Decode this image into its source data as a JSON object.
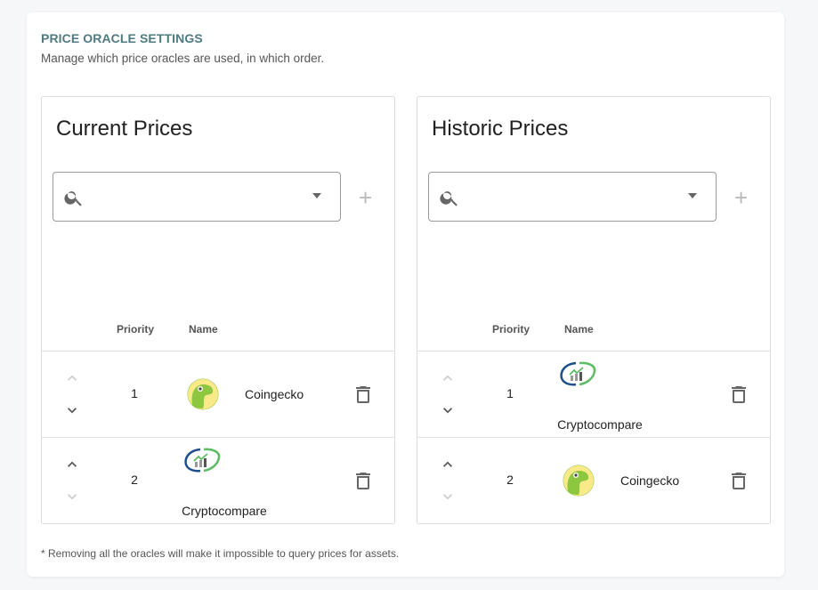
{
  "section": {
    "title": "PRICE ORACLE SETTINGS",
    "subtitle": "Manage which price oracles are used, in which order.",
    "footnote": "* Removing all the oracles will make it impossible to query prices for assets."
  },
  "columns": {
    "priority": "Priority",
    "name": "Name"
  },
  "current": {
    "title": "Current Prices",
    "search_value": "",
    "rows": [
      {
        "priority": "1",
        "name": "Coingecko",
        "logo": "coingecko"
      },
      {
        "priority": "2",
        "name": "Cryptocompare",
        "logo": "cryptocompare"
      }
    ]
  },
  "historic": {
    "title": "Historic Prices",
    "search_value": "",
    "rows": [
      {
        "priority": "1",
        "name": "Cryptocompare",
        "logo": "cryptocompare"
      },
      {
        "priority": "2",
        "name": "Coingecko",
        "logo": "coingecko"
      }
    ]
  },
  "icons": {
    "add": "+",
    "search": "search-icon",
    "dropdown": "menu-down-icon",
    "up": "chevron-up-icon",
    "down": "chevron-down-icon",
    "delete": "trash-icon"
  }
}
